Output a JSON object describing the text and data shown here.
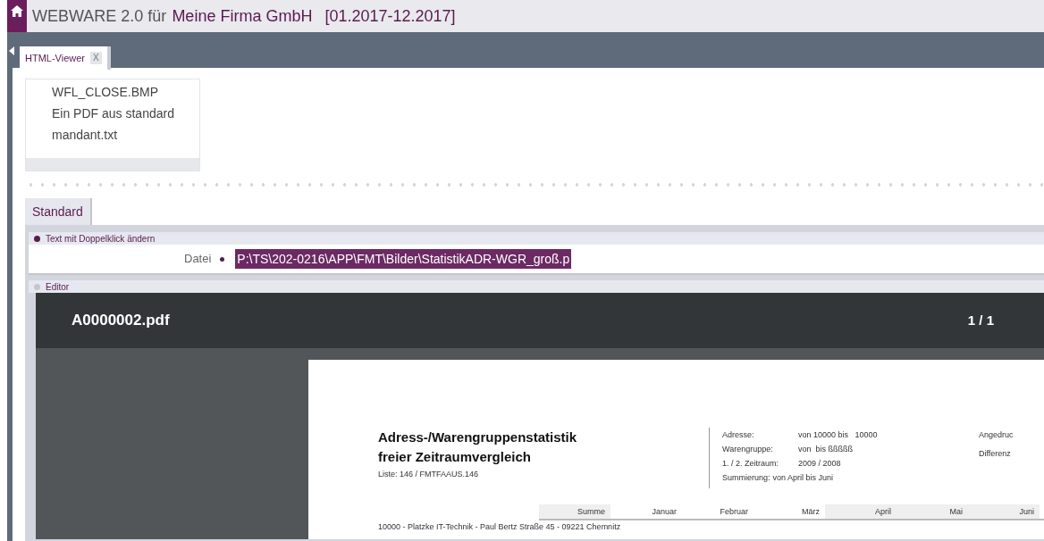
{
  "header": {
    "app": "WEBWARE 2.0 für",
    "company": "Meine Firma GmbH",
    "period": "[01.2017-12.2017]"
  },
  "tabs": [
    {
      "label": "HTML-Viewer",
      "close": "X",
      "selected": true
    }
  ],
  "files": [
    "WFL_CLOSE.BMP",
    "Ein PDF aus standard",
    "mandant.txt"
  ],
  "subtabs": [
    {
      "label": "Standard",
      "selected": true
    }
  ],
  "panels": [
    {
      "title": "Text mit Doppelklick ändern",
      "active": true,
      "field": {
        "label": "Datei",
        "value": "P:\\TS\\202-0216\\APP\\FMT\\Bilder\\StatistikADR-WGR_groß.p"
      }
    },
    {
      "title": "Editor",
      "active": false
    }
  ],
  "pdf": {
    "filename": "A0000002.pdf",
    "page": "1 / 1",
    "title_lines": [
      "Adress-/Warengruppenstatistik",
      "freier Zeitraumvergleich"
    ],
    "list": "Liste: 146 / FMTFAAUS.146",
    "info": [
      {
        "label": "Adresse:",
        "value": "von 10000 bis   10000"
      },
      {
        "label": "Warengruppe:",
        "value": "von  bis ßßßßß"
      },
      {
        "label": "1. / 2. Zeitraum:",
        "value": "2009 / 2008"
      },
      {
        "label": "Summierung:",
        "value": "von April bis Juni"
      }
    ],
    "right": [
      "Angedruc",
      "Differenz"
    ],
    "columns": [
      {
        "label": "Summe",
        "shaded": true
      },
      {
        "label": "Januar",
        "shaded": false
      },
      {
        "label": "Februar",
        "shaded": false
      },
      {
        "label": "März",
        "shaded": false
      },
      {
        "label": "April",
        "shaded": true
      },
      {
        "label": "Mai",
        "shaded": true
      },
      {
        "label": "Juni",
        "shaded": true
      }
    ],
    "row": "10000 - Platzke IT-Technik - Paul Bertz Straße 45 - 09221 Chemnitz"
  }
}
